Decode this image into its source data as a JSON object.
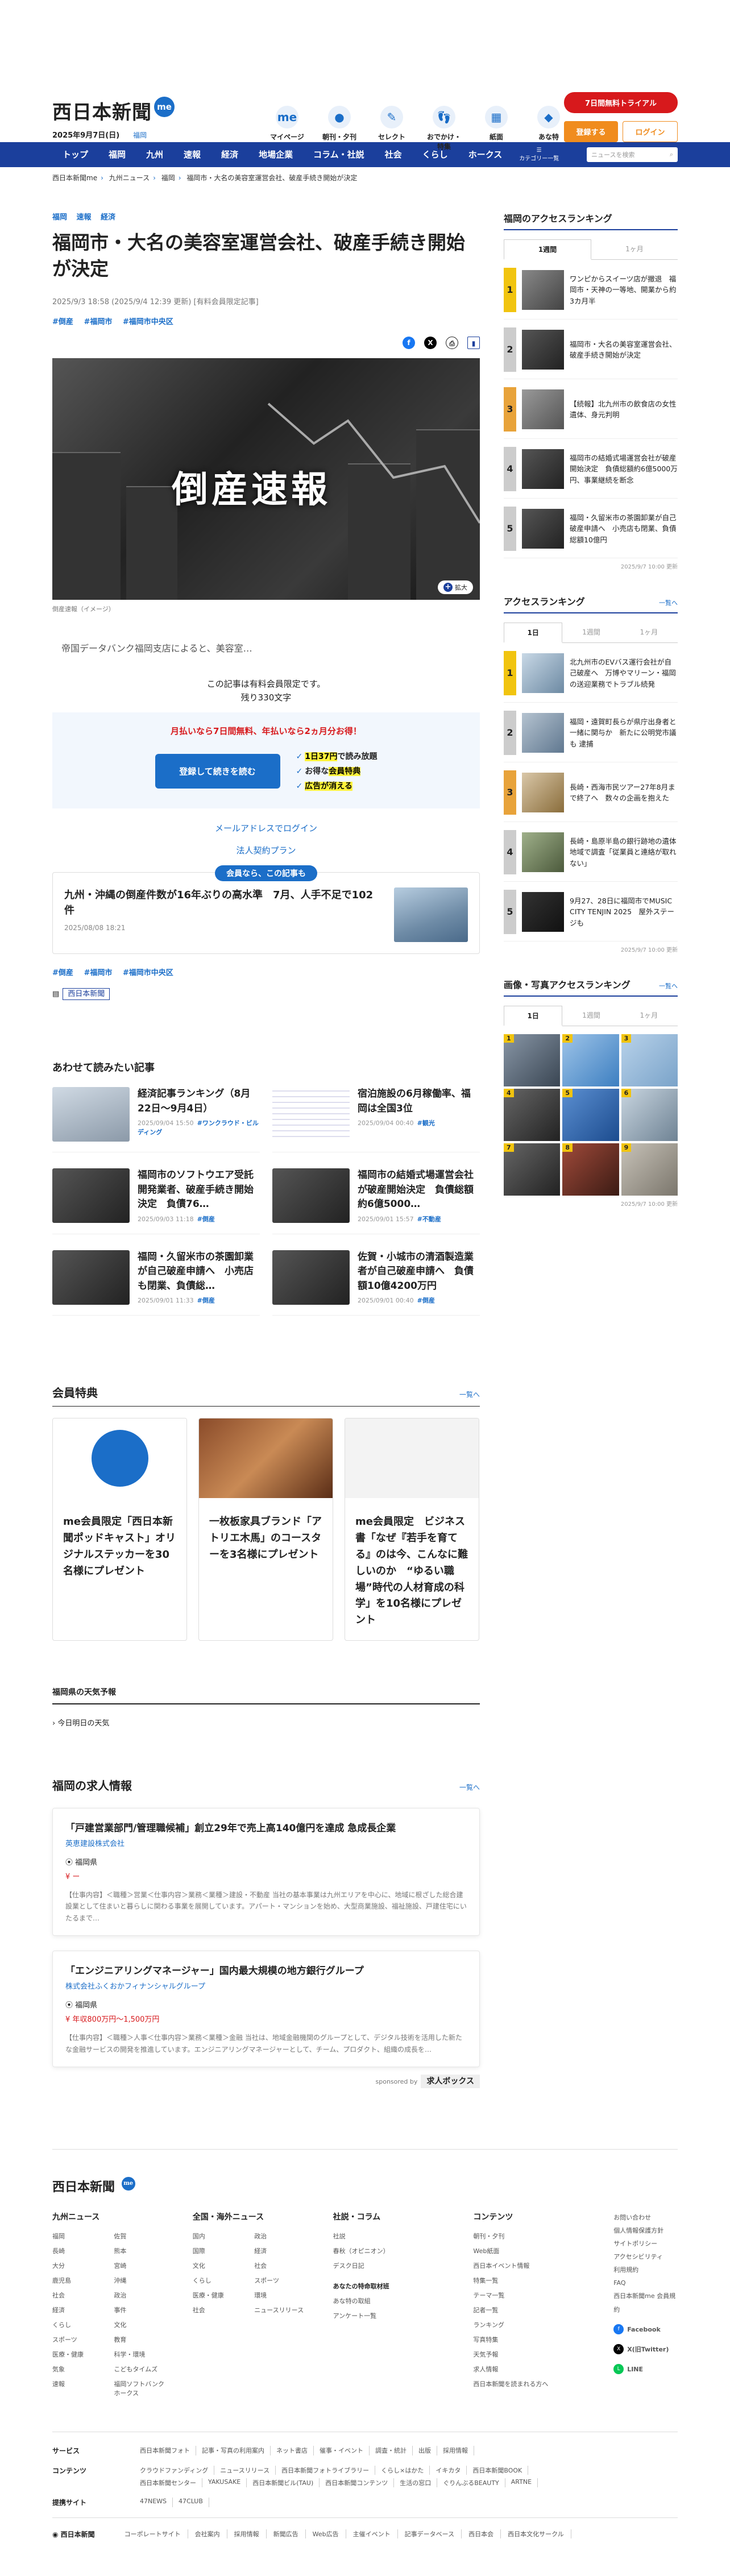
{
  "header": {
    "logo": "西日本新聞",
    "me": "me",
    "date": "2025年9月7日(日)",
    "pref": "福岡",
    "icons": [
      {
        "label": "マイページ",
        "icon": "me"
      },
      {
        "label": "朝刊・夕刊",
        "icon": "●"
      },
      {
        "label": "セレクト",
        "icon": "✎"
      },
      {
        "label": "おでかけ・特集",
        "icon": "👣"
      },
      {
        "label": "紙面",
        "icon": "▦"
      },
      {
        "label": "あな特",
        "icon": "◆"
      }
    ],
    "trial": "7日間無料トライアル",
    "register": "登録する",
    "login": "ログイン"
  },
  "nav": {
    "items": [
      "トップ",
      "福岡",
      "九州",
      "速報",
      "経済",
      "地場企業",
      "コラム・社説",
      "社会",
      "くらし",
      "ホークス"
    ],
    "category": "カテゴリー一覧",
    "search_placeholder": "ニュースを検索"
  },
  "breadcrumb": [
    "西日本新聞me",
    "九州ニュース",
    "福岡",
    "福岡市・大名の美容室運営会社、破産手続き開始が決定"
  ],
  "article": {
    "cats": [
      "福岡",
      "速報",
      "経済"
    ],
    "title": "福岡市・大名の美容室運営会社、破産手続き開始が決定",
    "meta": "2025/9/3 18:58 (2025/9/4 12:39 更新) [有料会員限定記事]",
    "tags": [
      "#倒産",
      "#福岡市",
      "#福岡市中央区"
    ],
    "hero_text": "倒産速報",
    "zoom": "拡大",
    "caption": "倒産速報（イメージ）",
    "lead": "帝国データバンク福岡支店によると、美容室…",
    "paywall_note1": "この記事は有料会員限定です。",
    "paywall_note2": "残り330文字",
    "pay_head": "月払いなら7日間無料、年払いなら2ヵ月分お得！",
    "pay_button": "登録して続きを読む",
    "benefit1a": "1日37円",
    "benefit1b": "で読み放題",
    "benefit2a": "お得な",
    "benefit2b": "会員特典",
    "benefit3": "広告が消える",
    "alt_login": "メールアドレスでログイン",
    "corp_plan": "法人契約プラン",
    "member_tag": "会員なら、この記事も",
    "member_title": "九州・沖縄の倒産件数が16年ぶりの高水準　7月、人手不足で102件",
    "member_date": "2025/08/08 18:21",
    "tags2": [
      "#倒産",
      "#福岡市",
      "#福岡市中央区"
    ],
    "paper_label": "西日本新聞"
  },
  "related": {
    "title": "あわせて読みたい記事",
    "items": [
      {
        "title": "経済記事ランキング（8月22日〜9月4日）",
        "date": "2025/09/04 15:50",
        "tag": "#ワンクラウド・ビルディング"
      },
      {
        "title": "宿泊施設の6月稼働率、福岡は全国3位",
        "date": "2025/09/04 00:40",
        "tag": "#観光"
      },
      {
        "title": "福岡市のソフトウエア受託開発業者、破産手続き開始決定　負債76…",
        "date": "2025/09/03 11:18",
        "tag": "#倒産"
      },
      {
        "title": "福岡市の結婚式場運営会社が破産開始決定　負債総額約6億5000…",
        "date": "2025/09/01 15:57",
        "tag": "#不動産"
      },
      {
        "title": "福岡・久留米市の茶園卸業が自己破産申請へ　小売店も閉業、負債総…",
        "date": "2025/09/01 11:33",
        "tag": "#倒産"
      },
      {
        "title": "佐賀・小城市の清酒製造業者が自己破産申請へ　負債額10億4200万円",
        "date": "2025/09/01 00:40",
        "tag": "#倒産"
      }
    ]
  },
  "benefits": {
    "title": "会員特典",
    "more": "一覧へ",
    "cards": [
      "me会員限定「西日本新聞ポッドキャスト」オリジナルステッカーを30名様にプレゼント",
      "一枚板家具ブランド「アトリエ木馬」のコースターを3名様にプレゼント",
      "me会員限定　ビジネス書「なぜ『若手を育てる』のは今、こんなに難しいのか　“ゆるい職場”時代の人材育成の科学」を10名様にプレゼント"
    ]
  },
  "weather": {
    "title": "福岡県の天気予報",
    "link": "今日明日の天気"
  },
  "jobs": {
    "title": "福岡の求人情報",
    "more": "一覧へ",
    "items": [
      {
        "title": "「戸建営業部門/管理職候補」創立29年で売上高140億円を達成 急成長企業",
        "company": "英恵建設株式会社",
        "loc": "福岡県",
        "salary": "ー",
        "desc": "【仕事内容】＜職種＞営業＜仕事内容＞業務＜業種＞建設・不動産 当社の基本事業は九州エリアを中心に、地域に根ざした総合建設業として住まいと暮らしに関わる事業を展開しています。アパート・マンションを始め、大型商業施設、福祉施設、戸建住宅にいたるまで…"
      },
      {
        "title": "「エンジニアリングマネージャー」国内最大規模の地方銀行グループ",
        "company": "株式会社ふくおかフィナンシャルグループ",
        "loc": "福岡県",
        "salary": "年収800万円〜1,500万円",
        "desc": "【仕事内容】＜職種＞人事＜仕事内容＞業務＜業種＞金融 当社は、地域金融機関のグループとして、デジタル技術を活用した新たな金融サービスの開発を推進しています。エンジニアリングマネージャーとして、チーム、プロダクト、組織の成長を…"
      }
    ],
    "sponsor": "sponsored by",
    "sponsor_name": "求人ボックス"
  },
  "sidebar": {
    "access_title": "福岡のアクセスランキング",
    "access_tabs": [
      "1週間",
      "1ヶ月"
    ],
    "access": [
      "ワンピからスイーツ店が撤退　福岡市・天神の一等地、開業から約3カ月半",
      "福岡市・大名の美容室運営会社、破産手続き開始が決定",
      "【続報】北九州市の飲食店の女性遺体、身元判明",
      "福岡市の結婚式場運営会社が破産開始決定　負債総額約6億5000万円、事業継続を断念",
      "福岡・久留米市の茶園卸業が自己破産申請へ　小売店も閉業、負債総額10億円"
    ],
    "access_stamp": "2025/9/7 10:00 更新",
    "access2_title": "アクセスランキング",
    "access2_more": "一覧へ",
    "access2_tabs": [
      "1日",
      "1週間",
      "1ヶ月"
    ],
    "access2": [
      "北九州市のEVバス運行会社が自己破産へ　万博やマリーン・福岡の送迎業務でトラブル続発",
      "福岡・遠賀町長らが県庁出身者と一緒に関与か　新たに公明党市議も 逮捕",
      "長崎・西海市民ツアー27年8月まで終了へ　数々の企画を抱えた",
      "長崎・島原半島の銀行跡地の遺体　地域で調査「従業員と連絡が取れない」",
      "9月27、28日に福岡市でMUSIC CITY TENJIN 2025　屋外ステージも"
    ],
    "access2_stamp": "2025/9/7 10:00 更新",
    "img_title": "画像・写真アクセスランキング",
    "img_more": "一覧へ",
    "img_tabs": [
      "1日",
      "1週間",
      "1ヶ月"
    ],
    "img_stamp": "2025/9/7 10:00 更新"
  },
  "footer": {
    "logo": "西日本新聞",
    "cols": [
      {
        "title": "九州ニュース",
        "items": [
          "福岡",
          "佐賀",
          "長崎",
          "熊本",
          "大分",
          "宮崎",
          "鹿児島",
          "沖縄",
          "社会",
          "政治",
          "経済",
          "事件",
          "くらし",
          "文化",
          "スポーツ",
          "教育",
          "医療・健康",
          "科学・環境",
          "気象",
          "こどもタイムズ",
          "速報",
          "福岡ソフトバンクホークス"
        ]
      },
      {
        "title": "全国・海外ニュース",
        "items": [
          "国内",
          "政治",
          "国際",
          "経済",
          "文化",
          "社会",
          "くらし",
          "スポーツ",
          "医療・健康",
          "環境",
          "社会",
          "ニュースリリース"
        ]
      },
      {
        "title": "社説・コラム",
        "items": [
          "社説",
          "春秋（オピニオン）",
          "デスク日記",
          "あなたの特命取材班",
          "あな特の取組",
          "アンケート一覧"
        ]
      },
      {
        "title": "コンテンツ",
        "items": [
          "朝刊・夕刊",
          "Web紙面",
          "西日本イベント情報",
          "特集一覧",
          "テーマ一覧",
          "記者一覧",
          "ランキング",
          "写真特集",
          "天気予報",
          "求人情報",
          "西日本新聞を読まれる方へ"
        ]
      }
    ],
    "misc": [
      "お問い合わせ",
      "個人情報保護方針",
      "サイトポリシー",
      "アクセシビリティ",
      "利用規約",
      "FAQ",
      "西日本新聞me 会員規約"
    ],
    "social": [
      "Facebook",
      "X(旧Twitter)",
      "LINE"
    ],
    "services_rows": [
      {
        "label": "サービス",
        "items": [
          "西日本新聞フォト",
          "記事・写真の利用案内",
          "ネット書店",
          "催事・イベント",
          "調査・統計",
          "出版",
          "採用情報"
        ]
      },
      {
        "label": "コンテンツ",
        "items": [
          "クラウドファンディング",
          "ニュースリリース",
          "西日本新聞フォトライブラリー",
          "くらし×はかた",
          "イキカタ",
          "西日本新聞BOOK",
          "西日本新聞センター",
          "YAKUSAKE",
          "西日本新聞ビル(TAU)",
          "西日本新聞コンテンツ",
          "生活の窓口",
          "ぐりんぶるBEAUTY",
          "ARTNE"
        ]
      },
      {
        "label": "提携サイト",
        "items": [
          "47NEWS",
          "47CLUB"
        ]
      }
    ],
    "bottom_logo": "西日本新聞",
    "bottom_links": [
      "コーポレートサイト",
      "会社案内",
      "採用情報",
      "新聞広告",
      "Web広告",
      "主催イベント",
      "記事データベース",
      "西日本会",
      "西日本文化サークル"
    ]
  }
}
